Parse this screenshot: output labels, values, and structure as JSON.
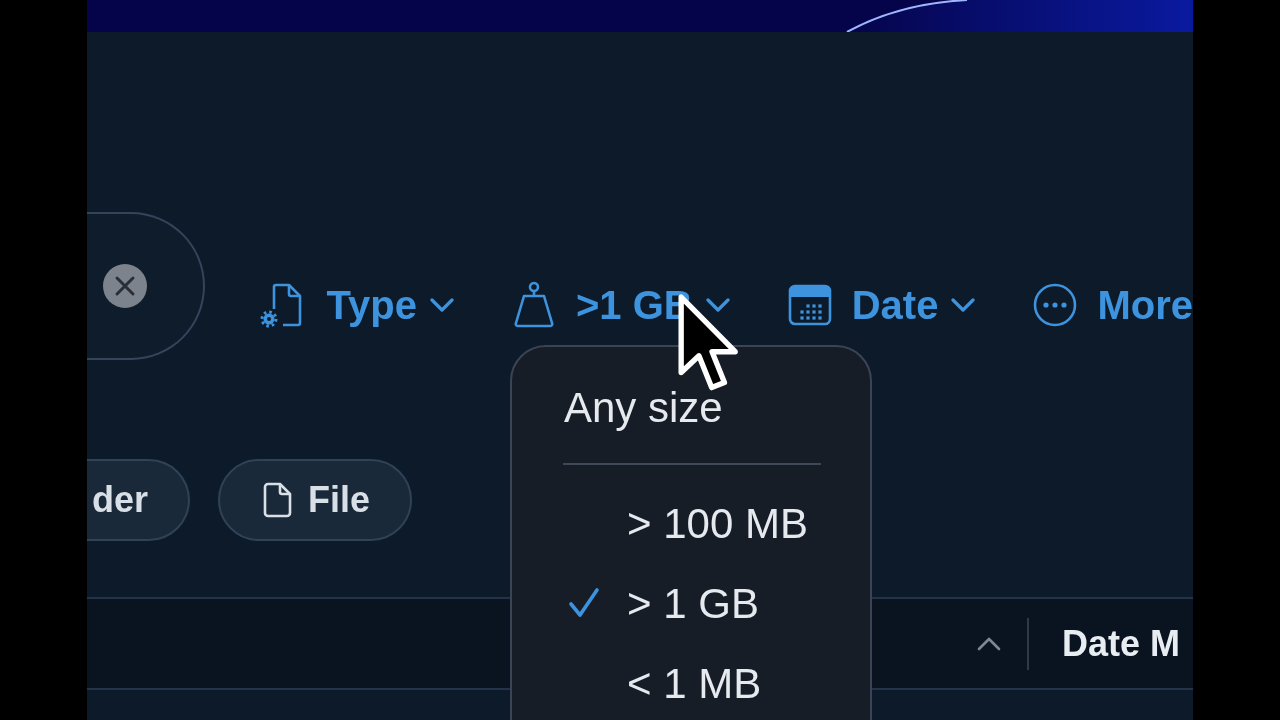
{
  "filters": [
    {
      "kind": "type",
      "label": "Type"
    },
    {
      "kind": "size",
      "label": ">1 GB"
    },
    {
      "kind": "date",
      "label": "Date"
    },
    {
      "kind": "more",
      "label": "More"
    }
  ],
  "chips": [
    {
      "kind": "plain",
      "label": "der"
    },
    {
      "kind": "file",
      "label": "File"
    }
  ],
  "table": {
    "sort_ascending": true,
    "columns": [
      {
        "label": "Date M"
      }
    ]
  },
  "size_menu": {
    "items": [
      {
        "kind": "reset",
        "label": "Any size",
        "selected": false
      },
      {
        "kind": "separator"
      },
      {
        "kind": "option",
        "label": "> 100 MB",
        "selected": false
      },
      {
        "kind": "option",
        "label": "> 1 GB",
        "selected": true
      },
      {
        "kind": "option",
        "label": "< 1 MB",
        "selected": false
      }
    ]
  }
}
